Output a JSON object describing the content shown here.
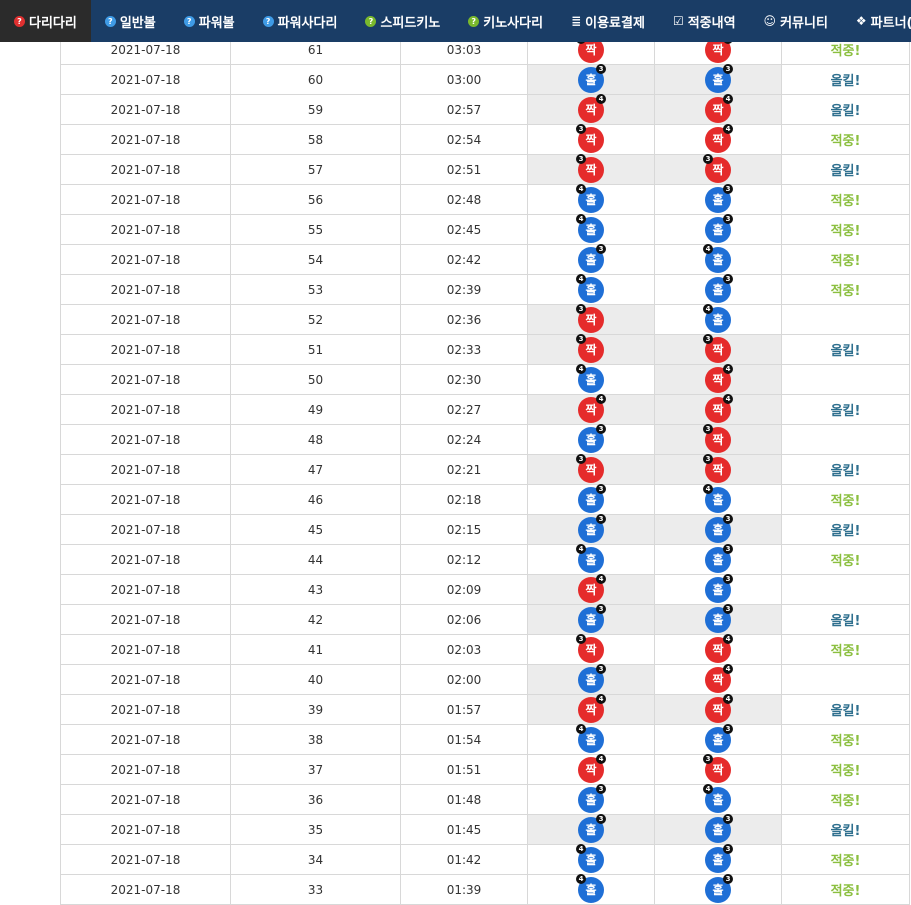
{
  "nav": {
    "items": [
      {
        "label": "다리다리",
        "icon": "question-red-icon",
        "active": true
      },
      {
        "label": "일반볼",
        "icon": "question-blue-icon"
      },
      {
        "label": "파워볼",
        "icon": "question-blue-icon"
      },
      {
        "label": "파워사다리",
        "icon": "question-blue-icon"
      },
      {
        "label": "스피드키노",
        "icon": "question-green-icon"
      },
      {
        "label": "키노사다리",
        "icon": "question-green-icon"
      },
      {
        "label": "이용료결제",
        "icon": "database-icon"
      },
      {
        "label": "적중내역",
        "icon": "checkbox-icon"
      },
      {
        "label": "커뮤니티",
        "icon": "smile-icon"
      },
      {
        "label": "파트너(V",
        "icon": "cubes-icon"
      }
    ]
  },
  "colors": {
    "nav_bg": "#1a3d66",
    "odd_red": "#e52b2b",
    "even_blue": "#1f6fd6",
    "hit_green": "#8bbf3f",
    "allkill_teal": "#2e6f8e"
  },
  "rows": [
    {
      "date": "2021-07-18",
      "round": "61",
      "time": "03:03",
      "pick1": {
        "text": "짝",
        "color": "red",
        "badge": "3",
        "pos": "left"
      },
      "pick1_shade": false,
      "pick2": {
        "text": "짝",
        "color": "red",
        "badge": "4",
        "pos": "right"
      },
      "pick2_shade": false,
      "result": "적중!",
      "rtype": "hit"
    },
    {
      "date": "2021-07-18",
      "round": "60",
      "time": "03:00",
      "pick1": {
        "text": "홀",
        "color": "blue",
        "badge": "3",
        "pos": "right"
      },
      "pick1_shade": true,
      "pick2": {
        "text": "홀",
        "color": "blue",
        "badge": "3",
        "pos": "right"
      },
      "pick2_shade": true,
      "result": "올킬!",
      "rtype": "kill"
    },
    {
      "date": "2021-07-18",
      "round": "59",
      "time": "02:57",
      "pick1": {
        "text": "짝",
        "color": "red",
        "badge": "4",
        "pos": "right"
      },
      "pick1_shade": true,
      "pick2": {
        "text": "짝",
        "color": "red",
        "badge": "4",
        "pos": "right"
      },
      "pick2_shade": true,
      "result": "올킬!",
      "rtype": "kill"
    },
    {
      "date": "2021-07-18",
      "round": "58",
      "time": "02:54",
      "pick1": {
        "text": "짝",
        "color": "red",
        "badge": "3",
        "pos": "left"
      },
      "pick1_shade": false,
      "pick2": {
        "text": "짝",
        "color": "red",
        "badge": "4",
        "pos": "right"
      },
      "pick2_shade": false,
      "result": "적중!",
      "rtype": "hit"
    },
    {
      "date": "2021-07-18",
      "round": "57",
      "time": "02:51",
      "pick1": {
        "text": "짝",
        "color": "red",
        "badge": "3",
        "pos": "left"
      },
      "pick1_shade": true,
      "pick2": {
        "text": "짝",
        "color": "red",
        "badge": "3",
        "pos": "left"
      },
      "pick2_shade": true,
      "result": "올킬!",
      "rtype": "kill"
    },
    {
      "date": "2021-07-18",
      "round": "56",
      "time": "02:48",
      "pick1": {
        "text": "홀",
        "color": "blue",
        "badge": "4",
        "pos": "left"
      },
      "pick1_shade": false,
      "pick2": {
        "text": "홀",
        "color": "blue",
        "badge": "3",
        "pos": "right"
      },
      "pick2_shade": false,
      "result": "적중!",
      "rtype": "hit"
    },
    {
      "date": "2021-07-18",
      "round": "55",
      "time": "02:45",
      "pick1": {
        "text": "홀",
        "color": "blue",
        "badge": "4",
        "pos": "left"
      },
      "pick1_shade": false,
      "pick2": {
        "text": "홀",
        "color": "blue",
        "badge": "3",
        "pos": "right"
      },
      "pick2_shade": false,
      "result": "적중!",
      "rtype": "hit"
    },
    {
      "date": "2021-07-18",
      "round": "54",
      "time": "02:42",
      "pick1": {
        "text": "홀",
        "color": "blue",
        "badge": "3",
        "pos": "right"
      },
      "pick1_shade": false,
      "pick2": {
        "text": "홀",
        "color": "blue",
        "badge": "4",
        "pos": "left"
      },
      "pick2_shade": false,
      "result": "적중!",
      "rtype": "hit"
    },
    {
      "date": "2021-07-18",
      "round": "53",
      "time": "02:39",
      "pick1": {
        "text": "홀",
        "color": "blue",
        "badge": "4",
        "pos": "left"
      },
      "pick1_shade": false,
      "pick2": {
        "text": "홀",
        "color": "blue",
        "badge": "3",
        "pos": "right"
      },
      "pick2_shade": false,
      "result": "적중!",
      "rtype": "hit"
    },
    {
      "date": "2021-07-18",
      "round": "52",
      "time": "02:36",
      "pick1": {
        "text": "짝",
        "color": "red",
        "badge": "3",
        "pos": "left"
      },
      "pick1_shade": true,
      "pick2": {
        "text": "홀",
        "color": "blue",
        "badge": "4",
        "pos": "left"
      },
      "pick2_shade": false,
      "result": "",
      "rtype": "none"
    },
    {
      "date": "2021-07-18",
      "round": "51",
      "time": "02:33",
      "pick1": {
        "text": "짝",
        "color": "red",
        "badge": "3",
        "pos": "left"
      },
      "pick1_shade": true,
      "pick2": {
        "text": "짝",
        "color": "red",
        "badge": "3",
        "pos": "left"
      },
      "pick2_shade": true,
      "result": "올킬!",
      "rtype": "kill"
    },
    {
      "date": "2021-07-18",
      "round": "50",
      "time": "02:30",
      "pick1": {
        "text": "홀",
        "color": "blue",
        "badge": "4",
        "pos": "left"
      },
      "pick1_shade": false,
      "pick2": {
        "text": "짝",
        "color": "red",
        "badge": "4",
        "pos": "right"
      },
      "pick2_shade": true,
      "result": "",
      "rtype": "none"
    },
    {
      "date": "2021-07-18",
      "round": "49",
      "time": "02:27",
      "pick1": {
        "text": "짝",
        "color": "red",
        "badge": "4",
        "pos": "right"
      },
      "pick1_shade": true,
      "pick2": {
        "text": "짝",
        "color": "red",
        "badge": "4",
        "pos": "right"
      },
      "pick2_shade": true,
      "result": "올킬!",
      "rtype": "kill"
    },
    {
      "date": "2021-07-18",
      "round": "48",
      "time": "02:24",
      "pick1": {
        "text": "홀",
        "color": "blue",
        "badge": "3",
        "pos": "right"
      },
      "pick1_shade": false,
      "pick2": {
        "text": "짝",
        "color": "red",
        "badge": "3",
        "pos": "left"
      },
      "pick2_shade": true,
      "result": "",
      "rtype": "none"
    },
    {
      "date": "2021-07-18",
      "round": "47",
      "time": "02:21",
      "pick1": {
        "text": "짝",
        "color": "red",
        "badge": "3",
        "pos": "left"
      },
      "pick1_shade": true,
      "pick2": {
        "text": "짝",
        "color": "red",
        "badge": "3",
        "pos": "left"
      },
      "pick2_shade": true,
      "result": "올킬!",
      "rtype": "kill"
    },
    {
      "date": "2021-07-18",
      "round": "46",
      "time": "02:18",
      "pick1": {
        "text": "홀",
        "color": "blue",
        "badge": "3",
        "pos": "right"
      },
      "pick1_shade": false,
      "pick2": {
        "text": "홀",
        "color": "blue",
        "badge": "4",
        "pos": "left"
      },
      "pick2_shade": false,
      "result": "적중!",
      "rtype": "hit"
    },
    {
      "date": "2021-07-18",
      "round": "45",
      "time": "02:15",
      "pick1": {
        "text": "홀",
        "color": "blue",
        "badge": "3",
        "pos": "right"
      },
      "pick1_shade": true,
      "pick2": {
        "text": "홀",
        "color": "blue",
        "badge": "3",
        "pos": "right"
      },
      "pick2_shade": true,
      "result": "올킬!",
      "rtype": "kill"
    },
    {
      "date": "2021-07-18",
      "round": "44",
      "time": "02:12",
      "pick1": {
        "text": "홀",
        "color": "blue",
        "badge": "4",
        "pos": "left"
      },
      "pick1_shade": false,
      "pick2": {
        "text": "홀",
        "color": "blue",
        "badge": "3",
        "pos": "right"
      },
      "pick2_shade": false,
      "result": "적중!",
      "rtype": "hit"
    },
    {
      "date": "2021-07-18",
      "round": "43",
      "time": "02:09",
      "pick1": {
        "text": "짝",
        "color": "red",
        "badge": "4",
        "pos": "right"
      },
      "pick1_shade": true,
      "pick2": {
        "text": "홀",
        "color": "blue",
        "badge": "3",
        "pos": "right"
      },
      "pick2_shade": false,
      "result": "",
      "rtype": "none"
    },
    {
      "date": "2021-07-18",
      "round": "42",
      "time": "02:06",
      "pick1": {
        "text": "홀",
        "color": "blue",
        "badge": "3",
        "pos": "right"
      },
      "pick1_shade": true,
      "pick2": {
        "text": "홀",
        "color": "blue",
        "badge": "3",
        "pos": "right"
      },
      "pick2_shade": true,
      "result": "올킬!",
      "rtype": "kill"
    },
    {
      "date": "2021-07-18",
      "round": "41",
      "time": "02:03",
      "pick1": {
        "text": "짝",
        "color": "red",
        "badge": "3",
        "pos": "left"
      },
      "pick1_shade": false,
      "pick2": {
        "text": "짝",
        "color": "red",
        "badge": "4",
        "pos": "right"
      },
      "pick2_shade": false,
      "result": "적중!",
      "rtype": "hit"
    },
    {
      "date": "2021-07-18",
      "round": "40",
      "time": "02:00",
      "pick1": {
        "text": "홀",
        "color": "blue",
        "badge": "3",
        "pos": "right"
      },
      "pick1_shade": true,
      "pick2": {
        "text": "짝",
        "color": "red",
        "badge": "4",
        "pos": "right"
      },
      "pick2_shade": false,
      "result": "",
      "rtype": "none"
    },
    {
      "date": "2021-07-18",
      "round": "39",
      "time": "01:57",
      "pick1": {
        "text": "짝",
        "color": "red",
        "badge": "4",
        "pos": "right"
      },
      "pick1_shade": true,
      "pick2": {
        "text": "짝",
        "color": "red",
        "badge": "4",
        "pos": "right"
      },
      "pick2_shade": true,
      "result": "올킬!",
      "rtype": "kill"
    },
    {
      "date": "2021-07-18",
      "round": "38",
      "time": "01:54",
      "pick1": {
        "text": "홀",
        "color": "blue",
        "badge": "4",
        "pos": "left"
      },
      "pick1_shade": false,
      "pick2": {
        "text": "홀",
        "color": "blue",
        "badge": "3",
        "pos": "right"
      },
      "pick2_shade": false,
      "result": "적중!",
      "rtype": "hit"
    },
    {
      "date": "2021-07-18",
      "round": "37",
      "time": "01:51",
      "pick1": {
        "text": "짝",
        "color": "red",
        "badge": "4",
        "pos": "right"
      },
      "pick1_shade": false,
      "pick2": {
        "text": "짝",
        "color": "red",
        "badge": "3",
        "pos": "left"
      },
      "pick2_shade": false,
      "result": "적중!",
      "rtype": "hit"
    },
    {
      "date": "2021-07-18",
      "round": "36",
      "time": "01:48",
      "pick1": {
        "text": "홀",
        "color": "blue",
        "badge": "3",
        "pos": "right"
      },
      "pick1_shade": false,
      "pick2": {
        "text": "홀",
        "color": "blue",
        "badge": "4",
        "pos": "left"
      },
      "pick2_shade": false,
      "result": "적중!",
      "rtype": "hit"
    },
    {
      "date": "2021-07-18",
      "round": "35",
      "time": "01:45",
      "pick1": {
        "text": "홀",
        "color": "blue",
        "badge": "3",
        "pos": "right"
      },
      "pick1_shade": true,
      "pick2": {
        "text": "홀",
        "color": "blue",
        "badge": "3",
        "pos": "right"
      },
      "pick2_shade": true,
      "result": "올킬!",
      "rtype": "kill"
    },
    {
      "date": "2021-07-18",
      "round": "34",
      "time": "01:42",
      "pick1": {
        "text": "홀",
        "color": "blue",
        "badge": "4",
        "pos": "left"
      },
      "pick1_shade": false,
      "pick2": {
        "text": "홀",
        "color": "blue",
        "badge": "3",
        "pos": "right"
      },
      "pick2_shade": false,
      "result": "적중!",
      "rtype": "hit"
    },
    {
      "date": "2021-07-18",
      "round": "33",
      "time": "01:39",
      "pick1": {
        "text": "홀",
        "color": "blue",
        "badge": "4",
        "pos": "left"
      },
      "pick1_shade": false,
      "pick2": {
        "text": "홀",
        "color": "blue",
        "badge": "3",
        "pos": "right"
      },
      "pick2_shade": false,
      "result": "적중!",
      "rtype": "hit"
    }
  ]
}
